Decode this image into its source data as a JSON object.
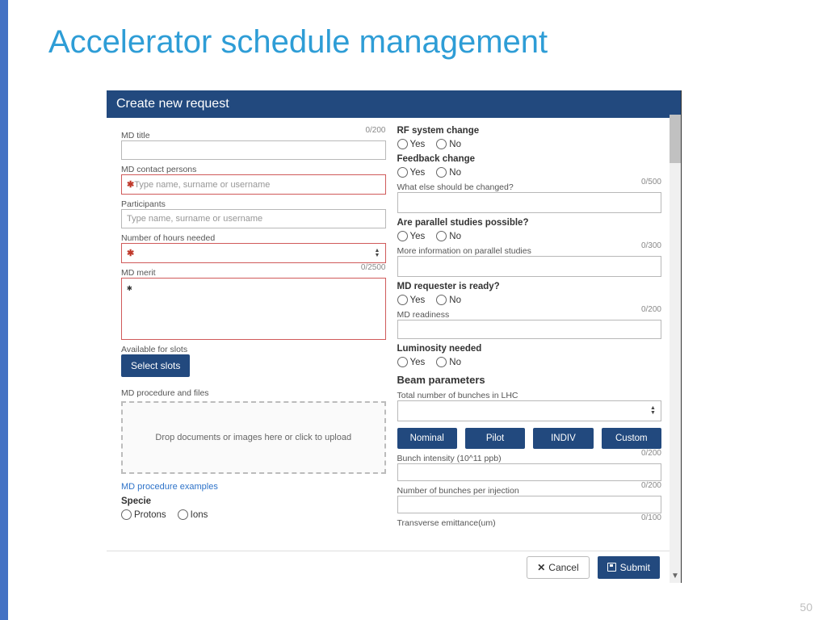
{
  "slide": {
    "title": "Accelerator schedule management",
    "page": "50"
  },
  "header": {
    "title": "Create new request"
  },
  "left": {
    "md_title": {
      "label": "MD title",
      "counter": "0/200"
    },
    "contact": {
      "label": "MD contact persons",
      "placeholder": "Type name, surname or username"
    },
    "participants": {
      "label": "Participants",
      "placeholder": "Type name, surname or username"
    },
    "hours": {
      "label": "Number of hours needed"
    },
    "merit": {
      "label": "MD merit",
      "counter": "0/2500"
    },
    "slots": {
      "label": "Available for slots",
      "button": "Select slots"
    },
    "proc": {
      "label": "MD procedure and files",
      "drop": "Drop documents or images here or click to upload",
      "examples": "MD procedure examples"
    },
    "specie": {
      "heading": "Specie",
      "opt1": "Protons",
      "opt2": "Ions"
    }
  },
  "right": {
    "rf": {
      "heading": "RF system change"
    },
    "fb": {
      "heading": "Feedback change",
      "changed_label": "What else should be changed?",
      "changed_counter": "0/500"
    },
    "parallel": {
      "heading": "Are parallel studies possible?",
      "info_label": "More information on parallel studies",
      "info_counter": "0/300"
    },
    "ready": {
      "heading": "MD requester is ready?",
      "readiness_label": "MD readiness",
      "readiness_counter": "0/200"
    },
    "lum": {
      "heading": "Luminosity needed"
    },
    "beam": {
      "heading": "Beam parameters",
      "bunches_label": "Total number of bunches in LHC",
      "buttons": [
        "Nominal",
        "Pilot",
        "INDIV",
        "Custom"
      ],
      "intensity_label": "Bunch intensity (10^11 ppb)",
      "intensity_counter": "0/200",
      "perinj_label": "Number of bunches per injection",
      "perinj_counter": "0/200",
      "emit_label": "Transverse emittance(um)",
      "emit_counter": "0/100"
    }
  },
  "yesno": {
    "yes": "Yes",
    "no": "No"
  },
  "footer": {
    "cancel": "Cancel",
    "submit": "Submit"
  }
}
